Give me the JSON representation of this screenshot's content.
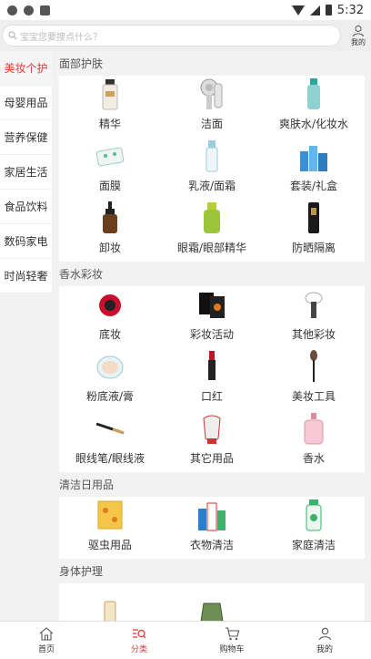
{
  "status_bar": {
    "time": "5:32"
  },
  "search": {
    "placeholder": "宝宝您要搜点什么？"
  },
  "header": {
    "mine_label": "我的"
  },
  "categories": [
    {
      "label": "美妆个护",
      "active": true
    },
    {
      "label": "母婴用品"
    },
    {
      "label": "营养保健"
    },
    {
      "label": "家居生活"
    },
    {
      "label": "食品饮料"
    },
    {
      "label": "数码家电"
    },
    {
      "label": "时尚轻奢"
    }
  ],
  "sections": [
    {
      "title": "面部护肤",
      "items": [
        "精华",
        "洁面",
        "爽肤水/化妆水",
        "面膜",
        "乳液/面霜",
        "套装/礼盒",
        "卸妆",
        "眼霜/眼部精华",
        "防晒隔离"
      ]
    },
    {
      "title": "香水彩妆",
      "items": [
        "底妆",
        "彩妆活动",
        "其他彩妆",
        "粉底液/膏",
        "口红",
        "美妆工具",
        "眼线笔/眼线液",
        "其它用品",
        "香水"
      ]
    },
    {
      "title": "清洁日用品",
      "items": [
        "驱虫用品",
        "衣物清洁",
        "家庭清洁"
      ]
    },
    {
      "title": "身体护理",
      "items": [
        "",
        ""
      ]
    }
  ],
  "tabbar": {
    "home": "首页",
    "category": "分类",
    "cart": "购物车",
    "mine": "我的"
  },
  "colors": {
    "accent": "#e4393c"
  }
}
